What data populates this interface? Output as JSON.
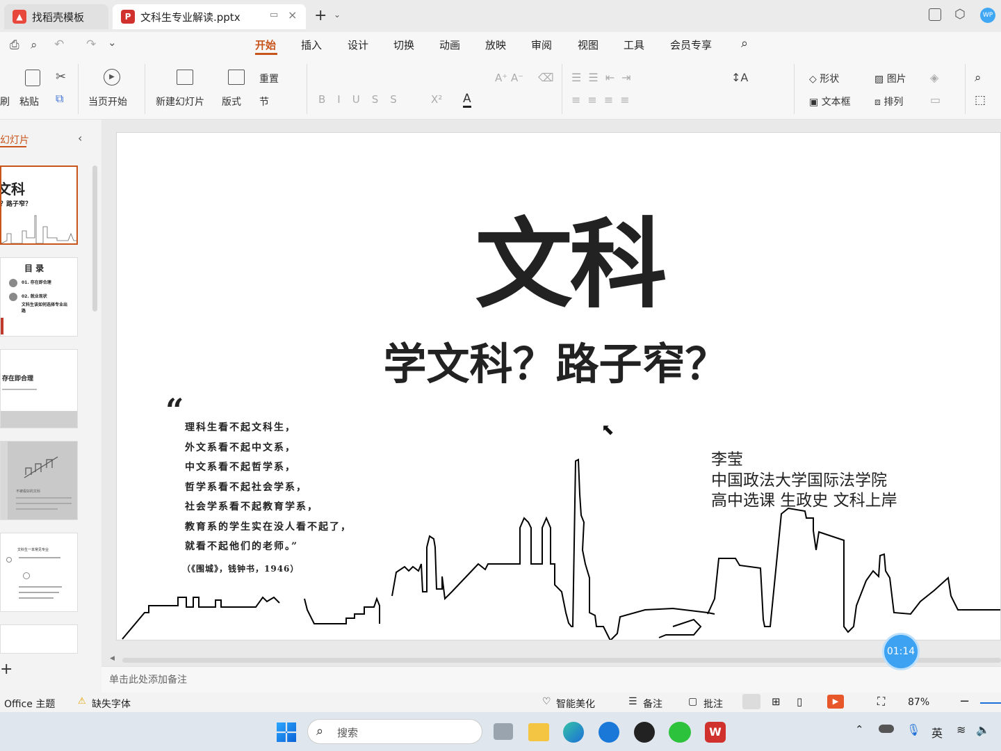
{
  "colors": {
    "accent": "#c7541b",
    "wps_red": "#d0312d",
    "brand_blue": "#1a6ed8"
  },
  "tabs": [
    {
      "label": "找稻壳模板",
      "icon": "daoke-icon"
    },
    {
      "label": "文科生专业解读.pptx",
      "icon": "ppt-file-icon"
    }
  ],
  "menu": [
    "开始",
    "插入",
    "设计",
    "切换",
    "动画",
    "放映",
    "审阅",
    "视图",
    "工具",
    "会员专享"
  ],
  "ribbon": {
    "brush": "刷",
    "paste": "粘贴",
    "current_start": "当页开始",
    "new_slide": "新建幻灯片",
    "layout": "版式",
    "reset": "重置",
    "section": "节",
    "shape": "形状",
    "textbox": "文本框",
    "image": "图片",
    "arrange": "排列"
  },
  "panel": {
    "title": "幻灯片",
    "thumb1": {
      "title": "文科",
      "sub": "？路子窄？"
    },
    "thumb2": {
      "title": "目 录",
      "item1": "01. 存在即合理",
      "item2": "02. 就业现状",
      "item3": "文科生该如何选择专业出路"
    },
    "thumb3": {
      "title": "存在即合理"
    },
    "thumb4": {
      "title": "不被看好的文科"
    },
    "thumb5": {
      "title": "文科生一本常见专业"
    }
  },
  "slide": {
    "title": "文科",
    "subtitle": "学文科？路子窄？",
    "quote_mark": "“",
    "quote_lines": [
      "理科生看不起文科生，",
      "外文系看不起中文系，",
      "中文系看不起哲学系，",
      "哲学系看不起社会学系，",
      "社会学系看不起教育学系，",
      "教育系的学生实在没人看不起了，",
      "就看不起他们的老师。”"
    ],
    "quote_source": "（《围城》，钱钟书，1946）",
    "author": "李莹",
    "affiliation": "中国政法大学国际法学院",
    "tagline": "高中选课 生政史 文科上岸"
  },
  "notes_placeholder": "单击此处添加备注",
  "timer": "01:14",
  "status": {
    "theme": "Office 主题",
    "missing_font": "缺失字体",
    "beautify": "智能美化",
    "notes": "备注",
    "comment": "批注",
    "zoom": "87%"
  },
  "taskbar": {
    "search_placeholder": "搜索",
    "ime": "英"
  }
}
